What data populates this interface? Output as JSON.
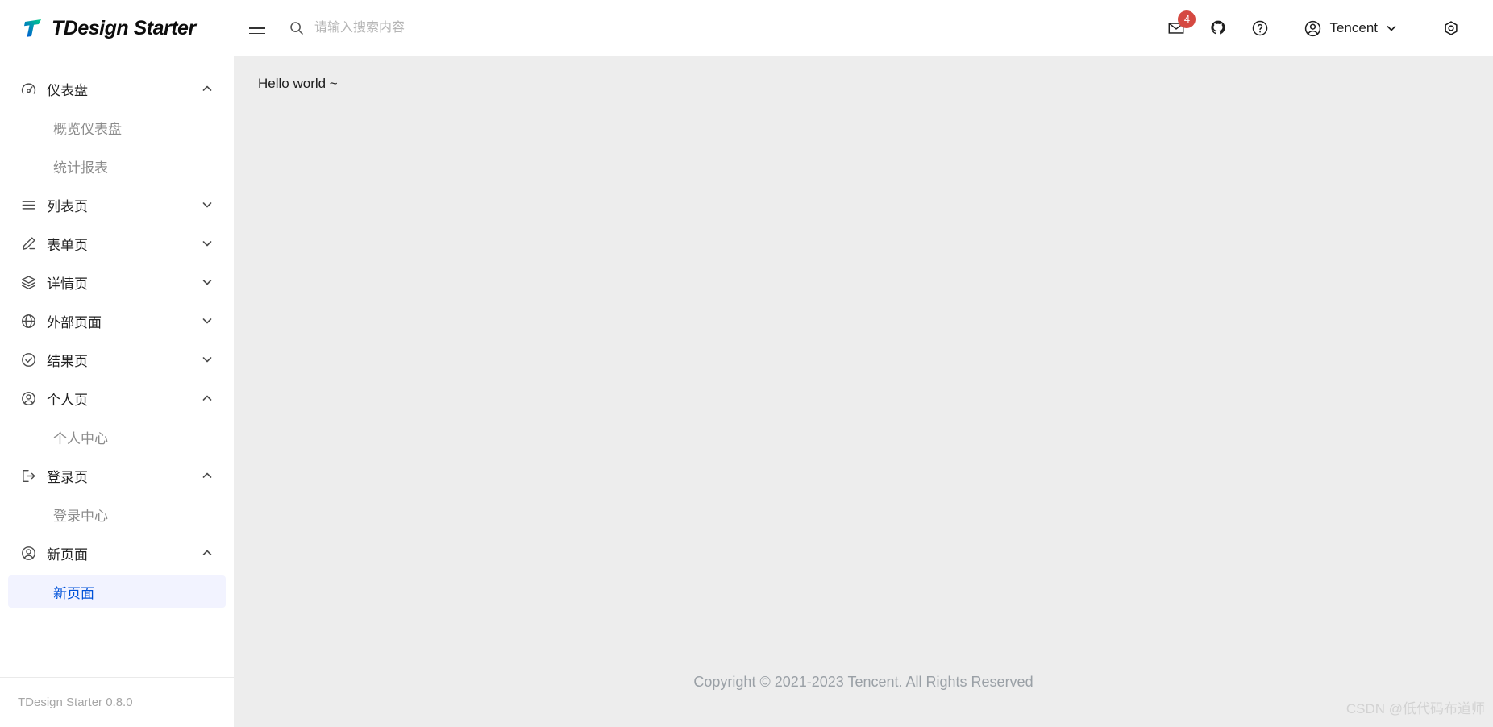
{
  "brand": {
    "name": "TDesign Starter",
    "logo_icon": "tdesign-logo-icon",
    "logo_colors": {
      "blue": "#0052d9",
      "green": "#00d08a",
      "dark": "#0d0d0d"
    }
  },
  "header": {
    "menu_toggle_icon": "hamburger-icon",
    "search": {
      "icon": "search-icon",
      "placeholder": "请输入搜索内容",
      "value": ""
    },
    "actions": [
      {
        "name": "mail-icon",
        "label": "邮件",
        "badge": "4"
      },
      {
        "name": "github-icon",
        "label": "GitHub",
        "badge": ""
      },
      {
        "name": "help-circle-icon",
        "label": "帮助",
        "badge": ""
      }
    ],
    "user": {
      "avatar_icon": "user-circle-icon",
      "name": "Tencent",
      "chevron_icon": "chevron-down-icon"
    },
    "settings_icon": "setting-nut-icon",
    "badge_color": "#d54941"
  },
  "sidebar": {
    "items": [
      {
        "label": "仪表盘",
        "icon": "dashboard-icon",
        "level": "parent",
        "chevron": "chevron-up-icon",
        "selected": false
      },
      {
        "label": "概览仪表盘",
        "icon": "",
        "level": "child",
        "chevron": "",
        "selected": false
      },
      {
        "label": "统计报表",
        "icon": "",
        "level": "child",
        "chevron": "",
        "selected": false
      },
      {
        "label": "列表页",
        "icon": "list-icon",
        "level": "parent",
        "chevron": "chevron-down-icon",
        "selected": false
      },
      {
        "label": "表单页",
        "icon": "edit-pencil-icon",
        "level": "parent",
        "chevron": "chevron-down-icon",
        "selected": false
      },
      {
        "label": "详情页",
        "icon": "layers-icon",
        "level": "parent",
        "chevron": "chevron-down-icon",
        "selected": false
      },
      {
        "label": "外部页面",
        "icon": "globe-icon",
        "level": "parent",
        "chevron": "chevron-down-icon",
        "selected": false
      },
      {
        "label": "结果页",
        "icon": "check-circle-icon",
        "level": "parent",
        "chevron": "chevron-down-icon",
        "selected": false
      },
      {
        "label": "个人页",
        "icon": "user-circle-icon",
        "level": "parent",
        "chevron": "chevron-up-icon",
        "selected": false
      },
      {
        "label": "个人中心",
        "icon": "",
        "level": "child",
        "chevron": "",
        "selected": false
      },
      {
        "label": "登录页",
        "icon": "logout-icon",
        "level": "parent",
        "chevron": "chevron-up-icon",
        "selected": false
      },
      {
        "label": "登录中心",
        "icon": "",
        "level": "child",
        "chevron": "",
        "selected": false
      },
      {
        "label": "新页面",
        "icon": "user-circle-icon",
        "level": "parent",
        "chevron": "chevron-up-icon",
        "selected": false
      },
      {
        "label": "新页面",
        "icon": "",
        "level": "child",
        "chevron": "",
        "selected": true
      }
    ],
    "footer_version": "TDesign Starter 0.8.0",
    "selected_bg": "#f2f3ff",
    "selected_fg": "#0052d9"
  },
  "main": {
    "hello_text": "Hello world ~",
    "copyright": "Copyright © 2021-2023 Tencent. All Rights Reserved",
    "background": "#ededed"
  },
  "watermark": {
    "text": "CSDN @低代码布道师"
  }
}
